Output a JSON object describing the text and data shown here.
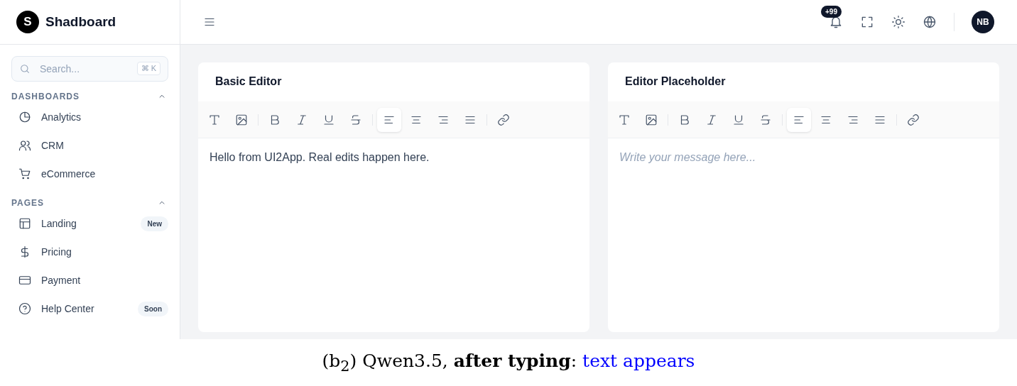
{
  "brand": {
    "logo_letter": "S",
    "name": "Shadboard"
  },
  "search": {
    "placeholder": "Search...",
    "shortcut": "⌘ K"
  },
  "sidebar": {
    "sections": [
      {
        "title": "DASHBOARDS",
        "expanded": true,
        "items": [
          {
            "label": "Analytics"
          },
          {
            "label": "CRM"
          },
          {
            "label": "eCommerce"
          }
        ]
      },
      {
        "title": "PAGES",
        "expanded": true,
        "items": [
          {
            "label": "Landing",
            "badge": "New"
          },
          {
            "label": "Pricing"
          },
          {
            "label": "Payment"
          },
          {
            "label": "Help Center",
            "badge": "Soon"
          }
        ]
      }
    ]
  },
  "header": {
    "notification_count": "+99",
    "avatar": "NB"
  },
  "editors": [
    {
      "title": "Basic Editor",
      "value": "Hello from UI2App. Real edits happen here.",
      "toolbar": [
        {
          "selected": false
        },
        {
          "selected": false
        },
        {
          "selected": false
        },
        {
          "selected": false
        },
        {
          "selected": false
        },
        {
          "selected": false
        },
        {
          "selected": true
        },
        {
          "selected": false
        },
        {
          "selected": false
        },
        {
          "selected": false
        },
        {
          "selected": false
        }
      ]
    },
    {
      "title": "Editor Placeholder",
      "placeholder": "Write your message here...",
      "toolbar": [
        {
          "selected": false
        },
        {
          "selected": false
        },
        {
          "selected": false
        },
        {
          "selected": false
        },
        {
          "selected": false
        },
        {
          "selected": false
        },
        {
          "selected": true
        },
        {
          "selected": false
        },
        {
          "selected": false
        },
        {
          "selected": false
        },
        {
          "selected": false
        }
      ]
    }
  ],
  "caption": {
    "text": "(b$_{2}$) Qwen3.5, **after typing**:",
    "highlight": "text appears"
  }
}
